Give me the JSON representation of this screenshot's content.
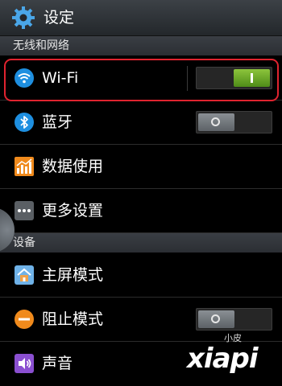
{
  "header": {
    "title": "设定",
    "icon": "gear-icon"
  },
  "sections": [
    {
      "header": "无线和网络"
    },
    {
      "header": "设备"
    }
  ],
  "rows": {
    "wifi": {
      "label": "Wi-Fi",
      "icon": "wifi-icon",
      "toggle": "on"
    },
    "bluetooth": {
      "label": "蓝牙",
      "icon": "bluetooth-icon",
      "toggle": "off"
    },
    "data_usage": {
      "label": "数据使用",
      "icon": "data-usage-icon"
    },
    "more_settings": {
      "label": "更多设置",
      "icon": "more-icon"
    },
    "home_mode": {
      "label": "主屏模式",
      "icon": "home-screen-icon"
    },
    "blocking_mode": {
      "label": "阻止模式",
      "icon": "blocking-icon",
      "toggle": "off"
    },
    "sound": {
      "label": "声音",
      "icon": "speaker-icon"
    }
  },
  "watermark": {
    "small": "小皮",
    "big": "xiapi"
  },
  "colors": {
    "highlight": "#e0232f",
    "toggle_on": "#6fae2a",
    "icon_blue": "#1e8fe0",
    "icon_orange": "#f08a1c"
  }
}
